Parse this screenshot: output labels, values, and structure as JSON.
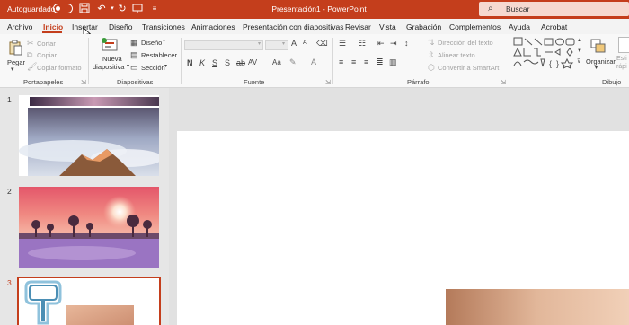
{
  "titlebar": {
    "autosave_label": "Autoguardado",
    "autosave_state": "off",
    "title": "Presentación1 - PowerPoint",
    "search_placeholder": "Buscar",
    "icons": [
      "save-icon",
      "undo-icon",
      "redo-icon",
      "present-icon",
      "customize-icon"
    ]
  },
  "menu": {
    "items": [
      "Archivo",
      "Inicio",
      "Insertar",
      "Diseño",
      "Transiciones",
      "Animaciones",
      "Presentación con diapositivas",
      "Revisar",
      "Vista",
      "Grabación",
      "Complementos",
      "Ayuda",
      "Acrobat"
    ],
    "active": "Inicio"
  },
  "ribbon": {
    "clipboard": {
      "label": "Portapapeles",
      "paste": "Pegar",
      "cut": "Cortar",
      "copy": "Copiar",
      "format_painter": "Copiar formato"
    },
    "slides": {
      "label": "Diapositivas",
      "new_slide": "Nueva",
      "new_slide_2": "diapositiva",
      "layout": "Diseño",
      "reset": "Restablecer",
      "section": "Sección"
    },
    "font": {
      "label": "Fuente",
      "bold": "N",
      "italic": "K",
      "underline": "S",
      "strike": "S",
      "spacing": "AV",
      "case": "Aa",
      "grow": "A",
      "shrink": "A"
    },
    "paragraph": {
      "label": "Párrafo",
      "text_direction": "Dirección del texto",
      "align_text": "Alinear texto",
      "smartart": "Convertir a SmartArt"
    },
    "drawing": {
      "label": "Dibujo",
      "arrange": "Organizar",
      "quick_styles": "Esti rápi"
    }
  },
  "slides": [
    {
      "number": "1",
      "selected": false
    },
    {
      "number": "2",
      "selected": false
    },
    {
      "number": "3",
      "selected": true
    }
  ],
  "colors": {
    "accent": "#c43e1c",
    "menubar": "#f3f3f3",
    "ribbon": "#f8f8f8"
  }
}
